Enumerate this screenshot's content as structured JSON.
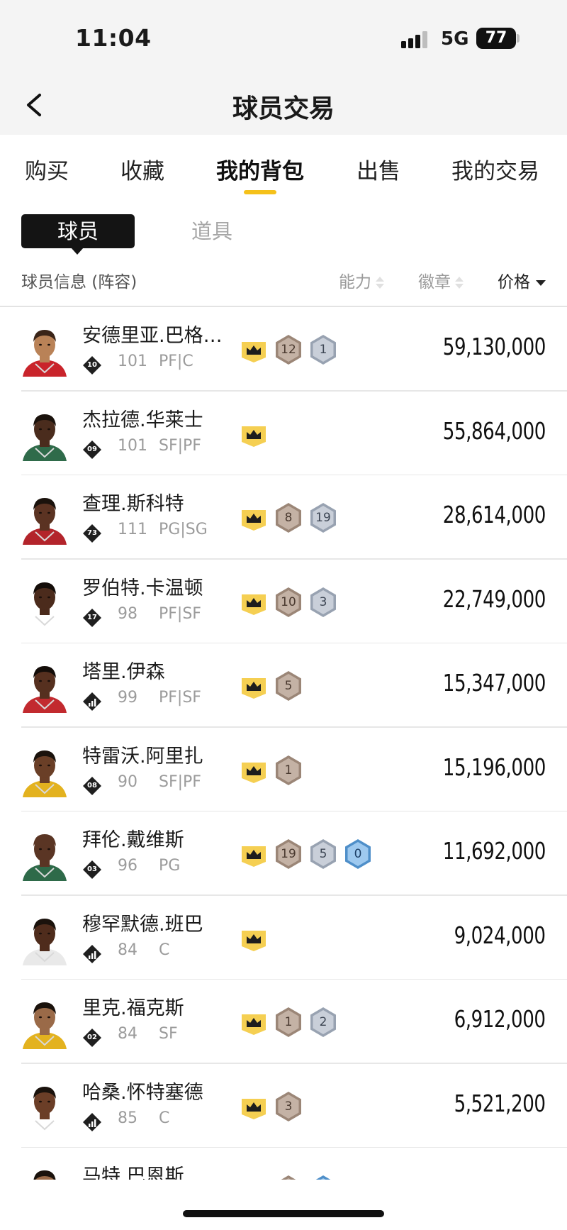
{
  "status_bar": {
    "time": "11:04",
    "network": "5G",
    "battery": "77"
  },
  "nav": {
    "title": "球员交易"
  },
  "tabs": [
    {
      "label": "购买",
      "active": false
    },
    {
      "label": "收藏",
      "active": false
    },
    {
      "label": "我的背包",
      "active": true
    },
    {
      "label": "出售",
      "active": false
    },
    {
      "label": "我的交易",
      "active": false
    }
  ],
  "segments": {
    "players": "球员",
    "items": "道具"
  },
  "columns": {
    "info": "球员信息 (阵容)",
    "ability": "能力",
    "badge": "徽章",
    "price": "价格"
  },
  "accent_color": "#f5c11a",
  "players": [
    {
      "name": "安德里亚.巴格…",
      "jersey": "10",
      "jersey_type": "number",
      "rating": "101",
      "position": "PF|C",
      "badges": [
        {
          "type": "crown"
        },
        {
          "type": "bronze",
          "value": "12"
        },
        {
          "type": "silver",
          "value": "1"
        }
      ],
      "price": "59,130,000",
      "skin": "#b98257",
      "hair": "#3a2418",
      "shirt": "#c9242b"
    },
    {
      "name": "杰拉德.华莱士",
      "jersey": "09",
      "jersey_type": "number",
      "rating": "101",
      "position": "SF|PF",
      "badges": [
        {
          "type": "crown"
        }
      ],
      "price": "55,864,000",
      "skin": "#4a2c1d",
      "hair": "#1a120c",
      "shirt": "#2f6b4a"
    },
    {
      "name": "查理.斯科特",
      "jersey": "73",
      "jersey_type": "number",
      "rating": "111",
      "position": "PG|SG",
      "badges": [
        {
          "type": "crown"
        },
        {
          "type": "bronze",
          "value": "8"
        },
        {
          "type": "silver",
          "value": "19"
        }
      ],
      "price": "28,614,000",
      "skin": "#5b3322",
      "hair": "#1a120c",
      "shirt": "#b3242b"
    },
    {
      "name": "罗伯特.卡温顿",
      "jersey": "17",
      "jersey_type": "number",
      "rating": "98",
      "position": "PF|SF",
      "badges": [
        {
          "type": "crown"
        },
        {
          "type": "bronze",
          "value": "10"
        },
        {
          "type": "silver",
          "value": "3"
        }
      ],
      "price": "22,749,000",
      "skin": "#4b2b1c",
      "hair": "#140d09",
      "shirt": "#ffffff"
    },
    {
      "name": "塔里.伊森",
      "jersey": "",
      "jersey_type": "bars",
      "rating": "99",
      "position": "PF|SF",
      "badges": [
        {
          "type": "crown"
        },
        {
          "type": "bronze",
          "value": "5"
        }
      ],
      "price": "15,347,000",
      "skin": "#56301f",
      "hair": "#140d09",
      "shirt": "#c22a2f"
    },
    {
      "name": "特雷沃.阿里扎",
      "jersey": "08",
      "jersey_type": "number",
      "rating": "90",
      "position": "SF|PF",
      "badges": [
        {
          "type": "crown"
        },
        {
          "type": "bronze",
          "value": "1"
        }
      ],
      "price": "15,196,000",
      "skin": "#6a3f27",
      "hair": "#1a120c",
      "shirt": "#e3b21f"
    },
    {
      "name": "拜伦.戴维斯",
      "jersey": "03",
      "jersey_type": "number",
      "rating": "96",
      "position": "PG",
      "badges": [
        {
          "type": "crown"
        },
        {
          "type": "bronze",
          "value": "19"
        },
        {
          "type": "silver",
          "value": "5"
        },
        {
          "type": "blue",
          "value": "0"
        }
      ],
      "price": "11,692,000",
      "skin": "#5a3524",
      "hair": "#5a3524",
      "shirt": "#2e6a49"
    },
    {
      "name": "穆罕默德.班巴",
      "jersey": "",
      "jersey_type": "bars",
      "rating": "84",
      "position": "C",
      "badges": [
        {
          "type": "crown"
        }
      ],
      "price": "9,024,000",
      "skin": "#4f2c1c",
      "hair": "#1a120c",
      "shirt": "#e9e9e9"
    },
    {
      "name": "里克.福克斯",
      "jersey": "02",
      "jersey_type": "number",
      "rating": "84",
      "position": "SF",
      "badges": [
        {
          "type": "crown"
        },
        {
          "type": "bronze",
          "value": "1"
        },
        {
          "type": "silver",
          "value": "2"
        }
      ],
      "price": "6,912,000",
      "skin": "#9a6a48",
      "hair": "#1a120c",
      "shirt": "#e3b21f"
    },
    {
      "name": "哈桑.怀特塞德",
      "jersey": "",
      "jersey_type": "bars",
      "rating": "85",
      "position": "C",
      "badges": [
        {
          "type": "crown"
        },
        {
          "type": "bronze",
          "value": "3"
        }
      ],
      "price": "5,521,200",
      "skin": "#6b3e27",
      "hair": "#1a120c",
      "shirt": "#ffffff"
    },
    {
      "name": "马特.巴恩斯",
      "jersey": "",
      "jersey_type": "bars",
      "rating": "",
      "position": "",
      "badges": [
        {
          "type": "crown"
        },
        {
          "type": "bronze",
          "value": ""
        },
        {
          "type": "blue",
          "value": ""
        }
      ],
      "price": "",
      "skin": "#9a6a48",
      "hair": "#1a120c",
      "shirt": "#ffffff"
    }
  ]
}
